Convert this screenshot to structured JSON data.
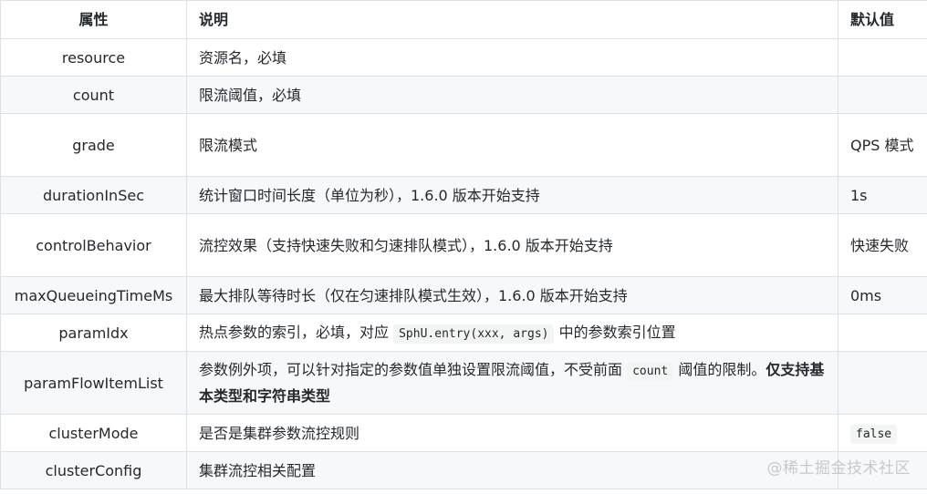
{
  "header": {
    "property": "属性",
    "description": "说明",
    "default": "默认值"
  },
  "rows": [
    {
      "property": "resource",
      "description": "资源名，必填",
      "default": ""
    },
    {
      "property": "count",
      "description": "限流阈值，必填",
      "default": ""
    },
    {
      "property": "grade",
      "description": "限流模式",
      "default": "QPS 模式"
    },
    {
      "property": "durationInSec",
      "description": "统计窗口时间长度（单位为秒），1.6.0 版本开始支持",
      "default": "1s"
    },
    {
      "property": "controlBehavior",
      "description": "流控效果（支持快速失败和匀速排队模式），1.6.0 版本开始支持",
      "default": "快速失败"
    },
    {
      "property": "maxQueueingTimeMs",
      "description": "最大排队等待时长（仅在匀速排队模式生效），1.6.0 版本开始支持",
      "default": "0ms"
    },
    {
      "property": "paramIdx",
      "description_pre": "热点参数的索引，必填，对应",
      "description_code": "SphU.entry(xxx, args)",
      "description_post": "中的参数索引位置",
      "default": ""
    },
    {
      "property": "paramFlowItemList",
      "description_pre": "参数例外项，可以针对指定的参数值单独设置限流阈值，不受前面",
      "description_code": "count",
      "description_post": "阈值的限制。",
      "description_bold": "仅支持基本类型和字符串类型",
      "default": ""
    },
    {
      "property": "clusterMode",
      "description": "是否是集群参数流控规则",
      "default_code": "false"
    },
    {
      "property": "clusterConfig",
      "description": "集群流控相关配置",
      "default": ""
    }
  ],
  "watermark": "@稀土掘金技术社区"
}
